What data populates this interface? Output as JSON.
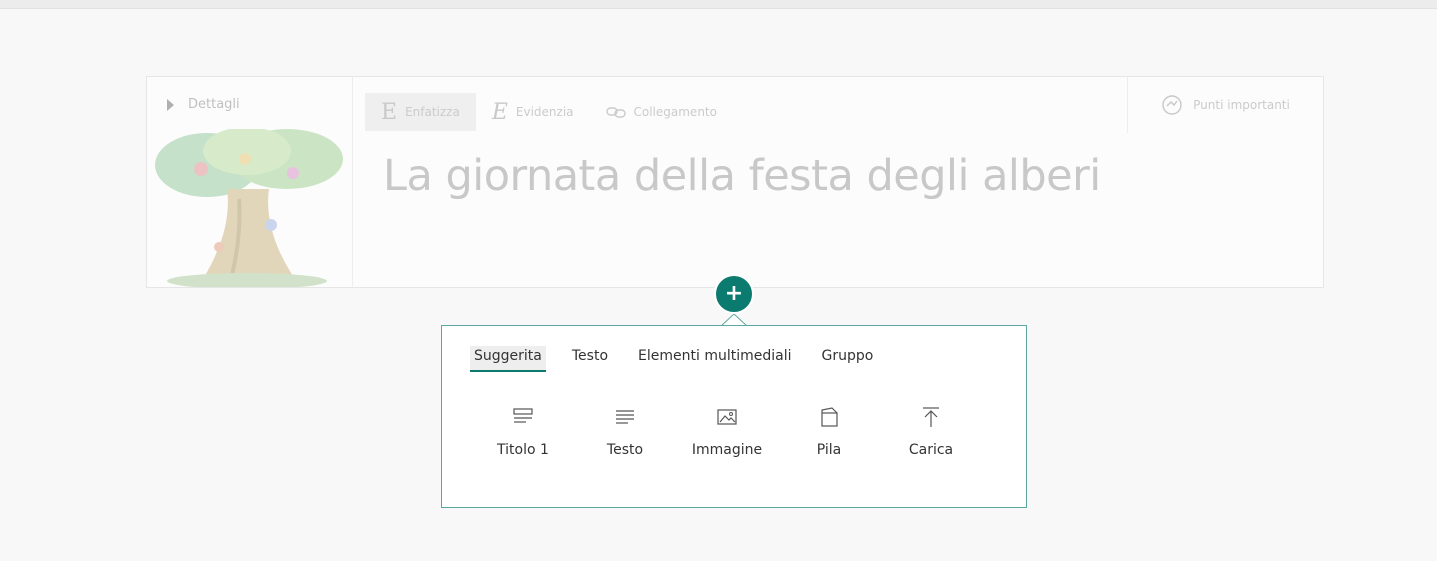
{
  "card": {
    "details_label": "Dettagli",
    "toolbar": [
      {
        "glyph": "E",
        "label": "Enfatizza",
        "active": true
      },
      {
        "glyph": "E",
        "label": "Evidenzia",
        "active": false
      },
      {
        "glyph": "link-icon",
        "label": "Collegamento",
        "active": false
      }
    ],
    "points_label": "Punti importanti",
    "title": "La giornata della festa degli alberi"
  },
  "add_button": {
    "glyph": "+"
  },
  "toolbox": {
    "tabs": [
      {
        "label": "Suggerita",
        "selected": true
      },
      {
        "label": "Testo",
        "selected": false
      },
      {
        "label": "Elementi multimediali",
        "selected": false
      },
      {
        "label": "Gruppo",
        "selected": false
      }
    ],
    "tiles": [
      {
        "icon": "heading-icon",
        "label": "Titolo 1"
      },
      {
        "icon": "text-icon",
        "label": "Testo"
      },
      {
        "icon": "image-icon",
        "label": "Immagine"
      },
      {
        "icon": "stack-icon",
        "label": "Pila"
      },
      {
        "icon": "upload-icon",
        "label": "Carica"
      }
    ]
  },
  "colors": {
    "accent": "#0b7b70",
    "flyout_border": "#5aa89f"
  }
}
